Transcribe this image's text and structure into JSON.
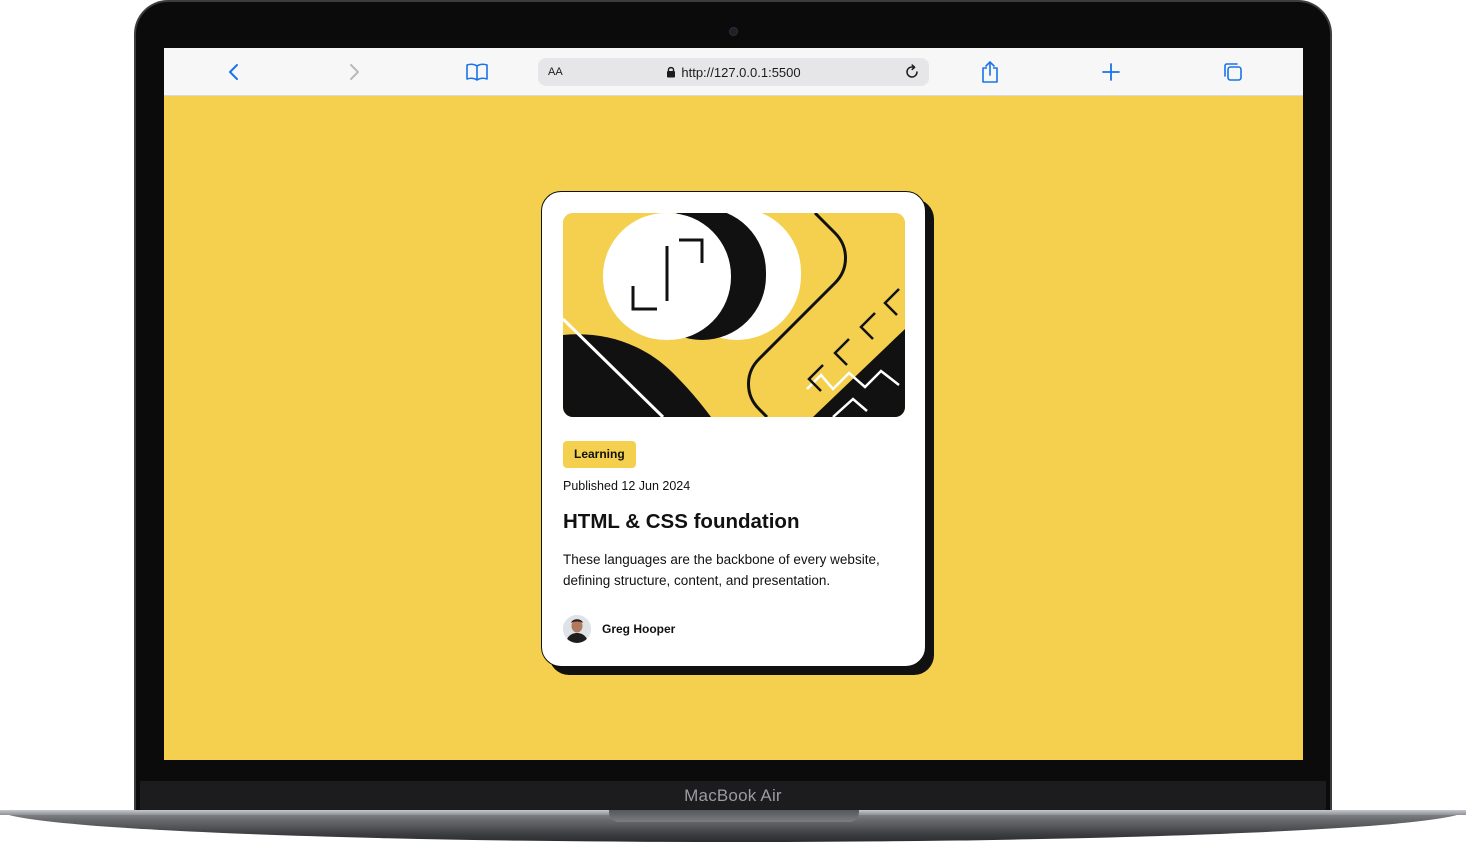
{
  "device": {
    "model_label": "MacBook Air"
  },
  "browser": {
    "reader_label": "AA",
    "url": "http://127.0.0.1:5500",
    "icons": [
      "chevron-left-icon",
      "chevron-right-icon",
      "book-icon",
      "lock-icon",
      "reload-icon",
      "share-icon",
      "plus-icon",
      "tabs-icon"
    ],
    "accent_color": "#1a73e8"
  },
  "page": {
    "background_color": "#f4d04e"
  },
  "card": {
    "category": "Learning",
    "published": "Published 12 Jun 2024",
    "title": "HTML & CSS foundation",
    "description": "These languages are the backbone of every website, defining structure, content, and presentation.",
    "author": "Greg Hooper",
    "accent_color": "#f4d04e",
    "ink_color": "#111111"
  }
}
